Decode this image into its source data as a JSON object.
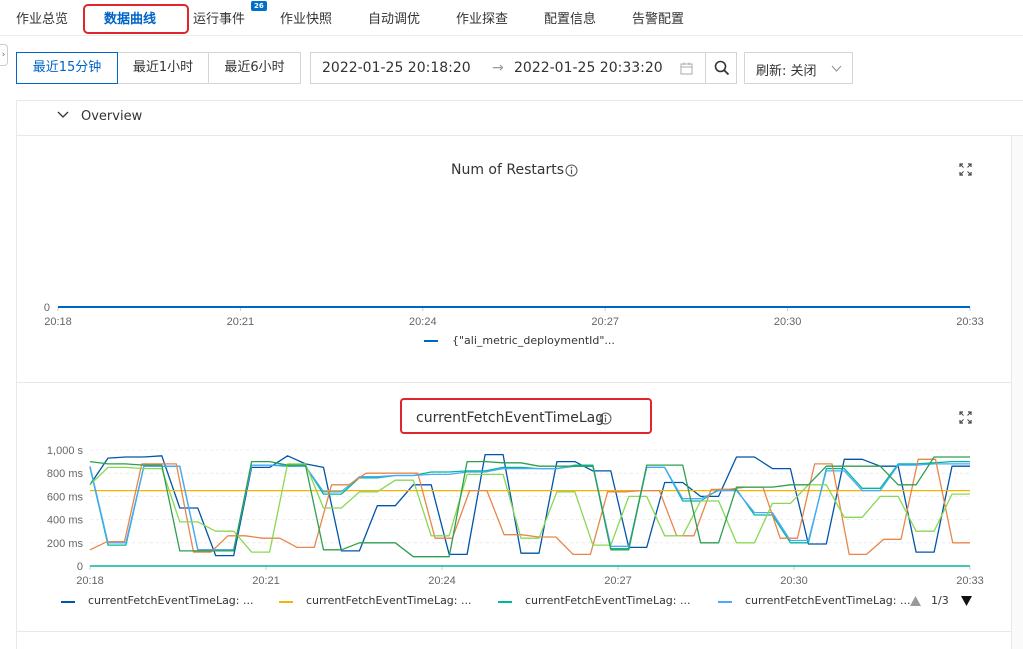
{
  "tabs": [
    {
      "label": "作业总览",
      "active": false
    },
    {
      "label": "数据曲线",
      "active": true
    },
    {
      "label": "运行事件",
      "active": false,
      "badge": "26"
    },
    {
      "label": "作业快照",
      "active": false
    },
    {
      "label": "自动调优",
      "active": false
    },
    {
      "label": "作业探查",
      "active": false
    },
    {
      "label": "配置信息",
      "active": false
    },
    {
      "label": "告警配置",
      "active": false
    }
  ],
  "time_ranges": [
    {
      "label": "最近15分钟",
      "active": true
    },
    {
      "label": "最近1小时",
      "active": false
    },
    {
      "label": "最近6小时",
      "active": false
    }
  ],
  "date_range": {
    "start": "2022-01-25 20:18:20",
    "separator": "→",
    "end": "2022-01-25 20:33:20"
  },
  "refresh": {
    "label": "刷新: 关闭"
  },
  "section": {
    "title": "Overview"
  },
  "accent_color": "#0064c8",
  "highlight_color": "#e0252d",
  "chart_data": [
    {
      "type": "line",
      "title": "Num of Restarts",
      "x": [
        "20:18",
        "20:21",
        "20:24",
        "20:27",
        "20:30",
        "20:33"
      ],
      "yticks": [
        "0"
      ],
      "ylim": [
        0,
        1
      ],
      "series": [
        {
          "name": "{\"ali_metric_deploymentId\"...",
          "color": "#0064c8",
          "values": [
            0,
            0,
            0,
            0,
            0,
            0
          ]
        }
      ],
      "legend_position": "bottom"
    },
    {
      "type": "line",
      "title": "currentFetchEventTimeLag",
      "x": [
        "20:18",
        "20:21",
        "20:24",
        "20:27",
        "20:30",
        "20:33"
      ],
      "yticks": [
        "1,000 s",
        "800 ms",
        "600 ms",
        "400 ms",
        "200 ms",
        "0"
      ],
      "legend": [
        {
          "name": "currentFetchEventTimeLag: ...",
          "color": "#0055aa"
        },
        {
          "name": "currentFetchEventTimeLag: ...",
          "color": "#f5b400"
        },
        {
          "name": "currentFetchEventTimeLag: ...",
          "color": "#00b898"
        },
        {
          "name": "currentFetchEventTimeLag: ...",
          "color": "#4aa8ff"
        }
      ],
      "legend_page": "1/3",
      "legend_position": "bottom",
      "series": [
        {
          "color": "#0055aa",
          "values": [
            700,
            930,
            940,
            940,
            950,
            500,
            500,
            90,
            90,
            850,
            850,
            950,
            880,
            850,
            130,
            130,
            520,
            520,
            700,
            700,
            100,
            100,
            960,
            960,
            110,
            110,
            900,
            900,
            820,
            820,
            160,
            160,
            720,
            720,
            600,
            600,
            940,
            940,
            840,
            840,
            190,
            190,
            920,
            920,
            860,
            860,
            120,
            120,
            860,
            860
          ]
        },
        {
          "color": "#f5b400",
          "values": [
            650,
            650,
            650,
            650,
            650,
            650,
            650,
            650,
            650,
            650,
            650,
            650,
            650,
            650,
            650,
            650,
            650,
            650,
            650,
            650,
            650,
            650,
            650,
            650,
            650,
            650,
            650,
            650,
            650,
            650,
            650,
            650,
            650,
            650,
            650,
            650,
            650,
            650,
            650,
            650,
            650,
            650,
            650,
            650,
            650,
            650,
            650,
            650,
            650,
            650
          ]
        },
        {
          "color": "#00b898",
          "values": [
            850,
            180,
            180,
            860,
            860,
            860,
            140,
            140,
            140,
            870,
            870,
            860,
            860,
            620,
            620,
            760,
            760,
            780,
            780,
            810,
            810,
            820,
            820,
            850,
            850,
            840,
            840,
            870,
            870,
            150,
            150,
            850,
            850,
            560,
            560,
            660,
            660,
            440,
            440,
            200,
            200,
            840,
            840,
            670,
            670,
            880,
            880,
            890,
            900,
            900
          ]
        },
        {
          "color": "#4aa8ff",
          "values": [
            860,
            200,
            200,
            860,
            860,
            860,
            140,
            140,
            140,
            870,
            870,
            870,
            860,
            640,
            640,
            770,
            770,
            780,
            780,
            790,
            790,
            810,
            810,
            840,
            840,
            840,
            840,
            860,
            860,
            170,
            170,
            850,
            850,
            580,
            580,
            650,
            650,
            460,
            460,
            220,
            220,
            820,
            820,
            650,
            650,
            870,
            870,
            880,
            880,
            880
          ]
        },
        {
          "color": "#e8864a",
          "values": [
            140,
            210,
            210,
            880,
            880,
            880,
            120,
            120,
            260,
            260,
            240,
            240,
            160,
            160,
            700,
            700,
            800,
            800,
            800,
            800,
            240,
            240,
            650,
            650,
            270,
            270,
            250,
            250,
            100,
            100,
            640,
            640,
            650,
            650,
            260,
            260,
            660,
            660,
            680,
            680,
            240,
            240,
            880,
            880,
            100,
            100,
            230,
            230,
            920,
            920,
            200,
            200
          ]
        },
        {
          "color": "#89d854",
          "values": [
            700,
            850,
            850,
            840,
            840,
            380,
            380,
            300,
            300,
            120,
            120,
            880,
            880,
            500,
            500,
            640,
            640,
            740,
            740,
            260,
            260,
            790,
            790,
            790,
            240,
            240,
            640,
            640,
            180,
            180,
            600,
            600,
            260,
            260,
            560,
            560,
            200,
            200,
            540,
            540,
            700,
            700,
            420,
            420,
            600,
            600,
            300,
            300,
            620,
            620
          ]
        },
        {
          "color": "#2e9f4f",
          "values": [
            900,
            880,
            880,
            870,
            870,
            130,
            130,
            130,
            130,
            900,
            900,
            870,
            870,
            140,
            140,
            200,
            200,
            200,
            80,
            80,
            80,
            900,
            900,
            890,
            890,
            860,
            860,
            860,
            860,
            140,
            140,
            870,
            870,
            870,
            200,
            200,
            680,
            680,
            680,
            700,
            700,
            860,
            860,
            860,
            860,
            700,
            700,
            940,
            940,
            940
          ]
        }
      ]
    }
  ]
}
